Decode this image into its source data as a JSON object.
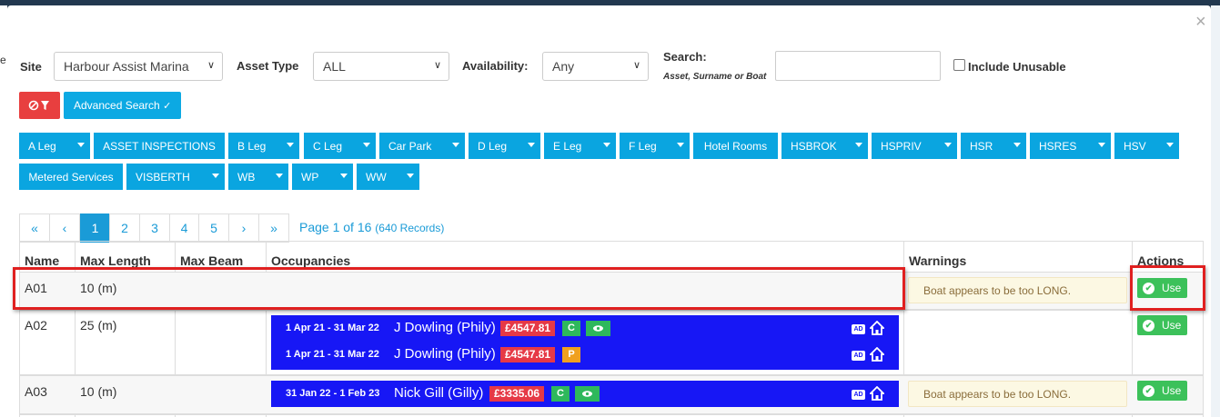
{
  "modal": {
    "close_label": "×"
  },
  "filters": {
    "site_label": "Site",
    "site_value": "Harbour Assist Marina",
    "asset_type_label": "Asset Type",
    "asset_type_value": "ALL",
    "availability_label": "Availability:",
    "availability_value": "Any",
    "search_label": "Search:",
    "search_hint": "Asset, Surname or Boat",
    "search_value": "",
    "include_unusable_label": "Include Unusable",
    "include_unusable_checked": false,
    "clear_filter_icon": "filter-off-icon",
    "advanced_search_label": "Advanced Search"
  },
  "asset_groups": [
    {
      "label": "A Leg",
      "dropdown": true
    },
    {
      "label": "ASSET INSPECTIONS",
      "dropdown": false
    },
    {
      "label": "B Leg",
      "dropdown": true
    },
    {
      "label": "C Leg",
      "dropdown": true
    },
    {
      "label": "Car Park",
      "dropdown": true
    },
    {
      "label": "D Leg",
      "dropdown": true
    },
    {
      "label": "E Leg",
      "dropdown": true
    },
    {
      "label": "F Leg",
      "dropdown": true
    },
    {
      "label": "Hotel Rooms",
      "dropdown": false
    },
    {
      "label": "HSBROK",
      "dropdown": true
    },
    {
      "label": "HSPRIV",
      "dropdown": true
    },
    {
      "label": "HSR",
      "dropdown": true
    },
    {
      "label": "HSRES",
      "dropdown": true
    },
    {
      "label": "HSV",
      "dropdown": true
    },
    {
      "label": "Metered Services",
      "dropdown": false
    },
    {
      "label": "VISBERTH",
      "dropdown": true
    },
    {
      "label": "WB",
      "dropdown": true
    },
    {
      "label": "WP",
      "dropdown": true
    },
    {
      "label": "WW",
      "dropdown": true
    }
  ],
  "pagination": {
    "first": "«",
    "prev": "‹",
    "pages": [
      "1",
      "2",
      "3",
      "4",
      "5"
    ],
    "active_page": "1",
    "next": "›",
    "last": "»",
    "info": "Page 1 of 16",
    "records": "(640 Records)"
  },
  "table": {
    "headers": [
      "Name",
      "Max Length",
      "Max Beam",
      "Occupancies",
      "Warnings",
      "Actions"
    ],
    "rows": [
      {
        "name": "A01",
        "max_length": "10 (m)",
        "max_beam": "",
        "occupancies": [],
        "warning": "Boat appears to be too LONG.",
        "action": "Use"
      },
      {
        "name": "A02",
        "max_length": "25 (m)",
        "max_beam": "",
        "occupancies": [
          {
            "dates": "1 Apr 21 - 31 Mar 22",
            "name": "J Dowling (Phily)",
            "amount": "£4547.81",
            "status": "C",
            "eye": true,
            "ad": "AD"
          },
          {
            "dates": "1 Apr 21 - 31 Mar 22",
            "name": "J Dowling (Phily)",
            "amount": "£4547.81",
            "status": "P",
            "eye": false,
            "ad": "AD"
          }
        ],
        "warning": "",
        "action": "Use"
      },
      {
        "name": "A03",
        "max_length": "10 (m)",
        "max_beam": "",
        "occupancies": [
          {
            "dates": "31 Jan 22 - 1 Feb 23",
            "name": "Nick Gill (Gilly)",
            "amount": "£3335.06",
            "status": "C",
            "eye": true,
            "ad": "AD"
          }
        ],
        "warning": "Boat appears to be too LONG.",
        "action": "Use"
      }
    ]
  },
  "colors": {
    "primary": "#0ca9e3",
    "danger": "#e83f3f",
    "success": "#3cc15a",
    "occupancy_bg": "#1717f5",
    "warning_bg": "#fcf8e3",
    "highlight": "#e02020"
  },
  "page_edges": {
    "left_glyph": "e"
  }
}
